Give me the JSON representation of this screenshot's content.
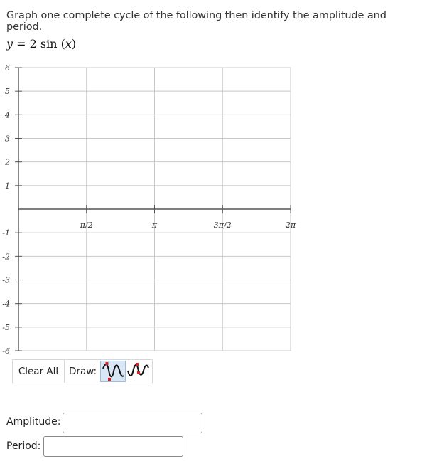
{
  "question": {
    "text": "Graph one complete cycle of the following then identify the amplitude and period."
  },
  "formula": {
    "lhs": "y",
    "eq": " = ",
    "coef": "2",
    "fn": "sin",
    "open": " (",
    "var": "x",
    "close": ")"
  },
  "graph": {
    "y_ticks": [
      "6",
      "5",
      "4",
      "3",
      "2",
      "1",
      "-1",
      "-2",
      "-3",
      "-4",
      "-5",
      "-6"
    ],
    "x_ticks": [
      "π/2",
      "π",
      "3π/2",
      "2π"
    ],
    "y_range": [
      -6,
      6
    ],
    "x_range": [
      0,
      6.283
    ],
    "grid": true,
    "colors": {
      "grid": "#c8c8c8",
      "axis": "#555555",
      "label": "#333333"
    }
  },
  "toolbar": {
    "clear_label": "Clear All",
    "draw_label": "Draw:",
    "tools": [
      {
        "icon": "sine-wave-icon",
        "selected": true
      },
      {
        "icon": "cosine-wave-icon",
        "selected": false
      }
    ],
    "tool_colors": {
      "wave": "#111111",
      "point": "#e02020",
      "selected_bg": "#d8e6f6"
    }
  },
  "fields": {
    "amplitude": {
      "label": "Amplitude:",
      "value": ""
    },
    "period": {
      "label": "Period:",
      "value": ""
    }
  }
}
